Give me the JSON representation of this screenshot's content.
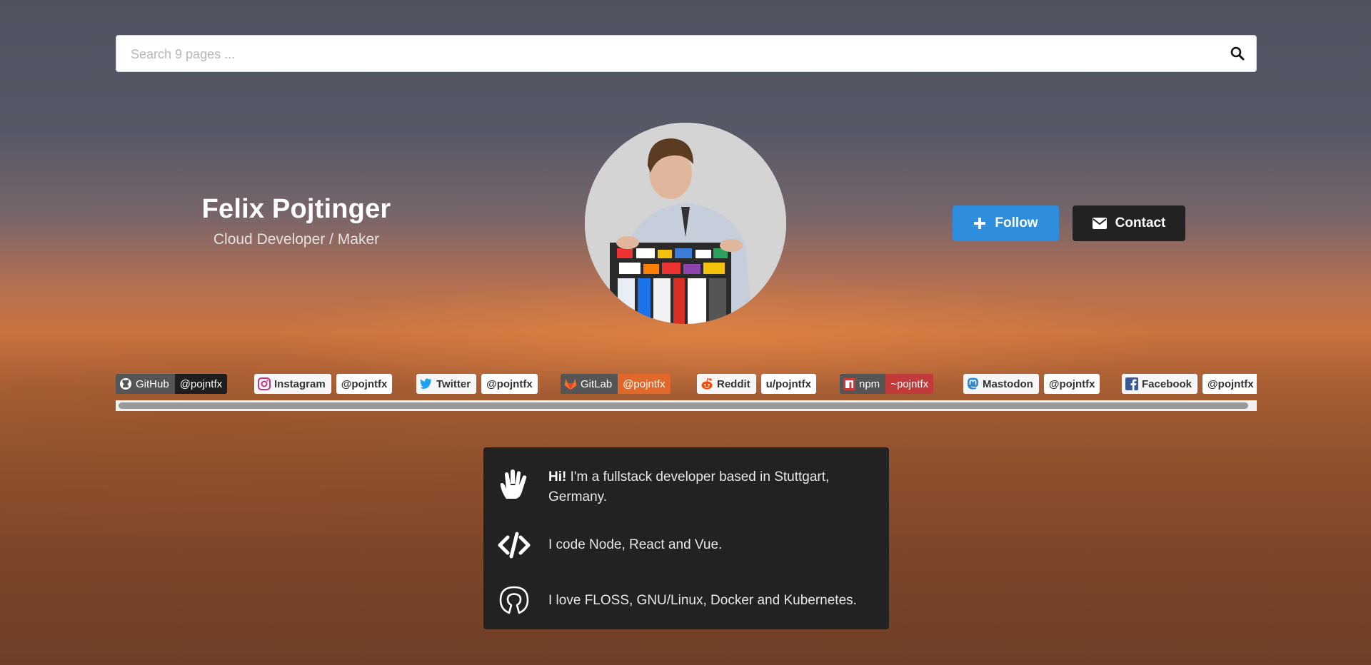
{
  "search": {
    "placeholder": "Search 9 pages ..."
  },
  "profile": {
    "name": "Felix Pojtinger",
    "subtitle": "Cloud Developer / Maker",
    "follow_label": "Follow",
    "contact_label": "Contact",
    "follow_color": "#2e8ddc",
    "contact_color": "#222222"
  },
  "badges": [
    {
      "label": "GitHub",
      "value": "@pojntfx",
      "icon": "github-icon"
    },
    {
      "label": "Instagram",
      "value": "@pojntfx",
      "icon": "instagram-icon"
    },
    {
      "label": "Twitter",
      "value": "@pojntfx",
      "icon": "twitter-icon"
    },
    {
      "label": "GitLab",
      "value": "@pojntfx",
      "icon": "gitlab-icon"
    },
    {
      "label": "Reddit",
      "value": "u/pojntfx",
      "icon": "reddit-icon"
    },
    {
      "label": "npm",
      "value": "~pojntfx",
      "icon": "npm-icon"
    },
    {
      "label": "Mastodon",
      "value": "@pojntfx",
      "icon": "mastodon-icon"
    },
    {
      "label": "Facebook",
      "value": "@pojntfx",
      "icon": "facebook-icon"
    }
  ],
  "about": {
    "greeting_bold": "Hi!",
    "greeting_rest": " I'm a fullstack developer based in Stuttgart, Germany.",
    "code_text": "I code Node, React and Vue.",
    "floss_text": "I love FLOSS, GNU/Linux, Docker and Kubernetes.",
    "icons": [
      "hand-icon",
      "code-icon",
      "open-source-icon"
    ]
  }
}
